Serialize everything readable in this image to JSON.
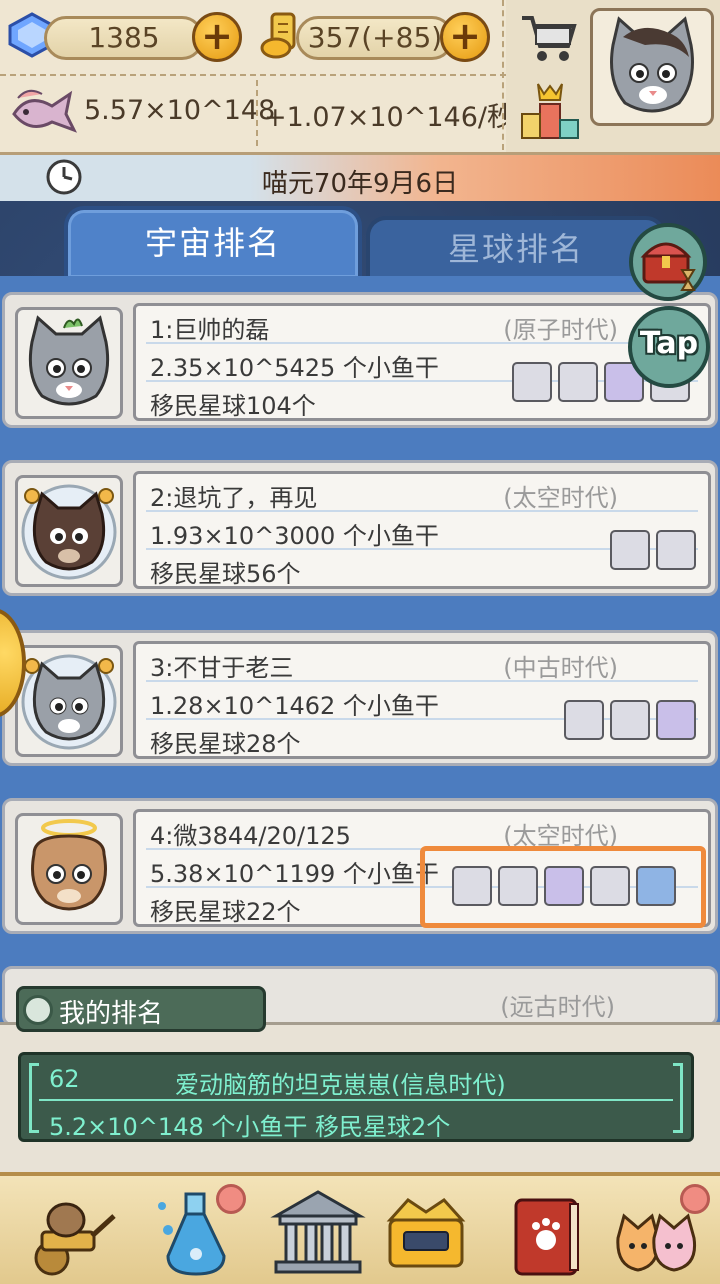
{
  "currency": {
    "gems": "1385",
    "scrolls": "357(+85)"
  },
  "stats": {
    "fish_total": "5.57×10^148",
    "fish_rate": "+1.07×10^146/秒"
  },
  "date": "喵元70年9月6日",
  "tabs": {
    "universe": "宇宙排名",
    "planet": "星球排名"
  },
  "side_buttons": {
    "tap": "Tap"
  },
  "rankings": [
    {
      "name": "1:巨帅的磊",
      "era": "(原子时代)",
      "fish": "2.35×10^5425 个小鱼干",
      "planets": "移民星球104个",
      "techs": [
        "factory-icon",
        "lab-icon",
        "atom-icon",
        "rocket-icon"
      ]
    },
    {
      "name": "2:退坑了，再见",
      "era": "(太空时代)",
      "fish": "1.93×10^3000 个小鱼干",
      "planets": "移民星球56个",
      "techs": [
        "factory-icon",
        "lab-icon"
      ]
    },
    {
      "name": "3:不甘于老三",
      "era": "(中古时代)",
      "fish": "1.28×10^1462 个小鱼干",
      "planets": "移民星球28个",
      "techs": [
        "factory-icon",
        "lab-icon",
        "atom-icon"
      ]
    },
    {
      "name": "4:微3844/20/125",
      "era": "(太空时代)",
      "fish": "5.38×10^1199 个小鱼干",
      "planets": "移民星球22个",
      "techs": [
        "factory-icon",
        "lab-icon",
        "atom-icon",
        "rocket-icon",
        "spaceship-icon"
      ]
    },
    {
      "name": "",
      "era": "(远古时代)",
      "fish": "",
      "planets": "",
      "techs": []
    }
  ],
  "my_rank": {
    "title": "我的排名",
    "rank": "62",
    "name": "爱动脑筋的坦克崽崽(信息时代)",
    "fish": "5.2×10^148 个小鱼干",
    "planets": "移民星球2个"
  },
  "colors": {
    "highlight": "#ef8a3c",
    "tab_active": "#4f82c9",
    "list_bg": "#4c7cbf",
    "terminal_text": "#7ff0cf"
  }
}
